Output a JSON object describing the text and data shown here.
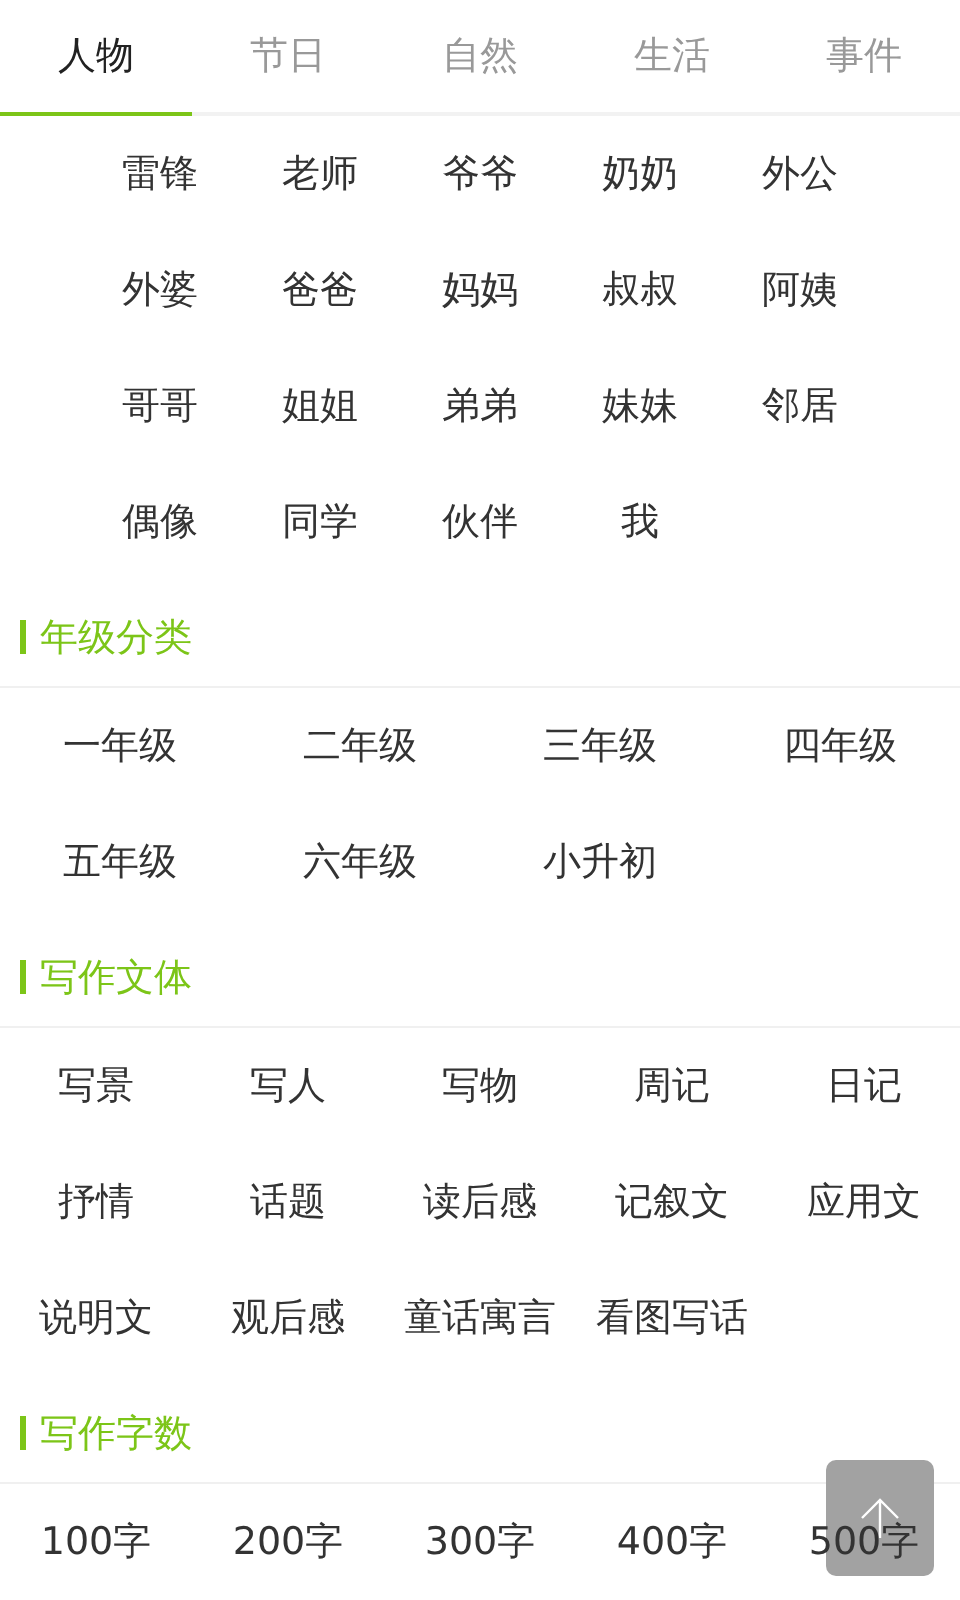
{
  "tabs": [
    {
      "label": "人物",
      "selected": true
    },
    {
      "label": "节日",
      "selected": false
    },
    {
      "label": "自然",
      "selected": false
    },
    {
      "label": "生活",
      "selected": false
    },
    {
      "label": "事件",
      "selected": false
    }
  ],
  "groups": [
    {
      "kind": "inset",
      "items": [
        "雷锋",
        "老师",
        "爷爷",
        "奶奶",
        "外公",
        "外婆",
        "爸爸",
        "妈妈",
        "叔叔",
        "阿姨",
        "哥哥",
        "姐姐",
        "弟弟",
        "妹妹",
        "邻居",
        "偶像",
        "同学",
        "伙伴",
        "我"
      ]
    },
    {
      "kind": "wide",
      "title": "年级分类",
      "items": [
        "一年级",
        "二年级",
        "三年级",
        "四年级",
        "五年级",
        "六年级",
        "小升初"
      ]
    },
    {
      "kind": "regular",
      "title": "写作文体",
      "items": [
        "写景",
        "写人",
        "写物",
        "周记",
        "日记",
        "抒情",
        "话题",
        "读后感",
        "记叙文",
        "应用文",
        "说明文",
        "观后感",
        "童话寓言",
        "看图写话"
      ]
    },
    {
      "kind": "regular",
      "title": "写作字数",
      "items": [
        "100字",
        "200字",
        "300字",
        "400字",
        "500字"
      ]
    }
  ]
}
